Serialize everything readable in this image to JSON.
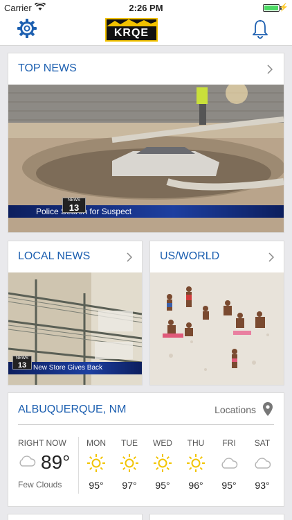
{
  "status_bar": {
    "carrier": "Carrier",
    "time": "2:26 PM"
  },
  "header": {
    "logo_text": "KRQE",
    "settings_icon": "gear-icon",
    "notifications_icon": "bell-icon"
  },
  "colors": {
    "accent": "#1c5fb0",
    "sun": "#f2c400",
    "logo_bg": "#f2c200",
    "battery": "#4cd964"
  },
  "top_news": {
    "title": "TOP NEWS",
    "station_tag": "NEWS",
    "channel": "13",
    "caption": "Police Search for Suspect"
  },
  "local_news": {
    "title": "LOCAL NEWS",
    "station_tag": "NEWS",
    "channel": "13",
    "caption": "New Store Gives Back"
  },
  "us_world": {
    "title": "US/WORLD"
  },
  "weather": {
    "city": "ALBUQUERQUE, NM",
    "locations_label": "Locations",
    "now_label": "RIGHT NOW",
    "now_temp": "89°",
    "now_condition": "Few Clouds",
    "now_icon": "cloud-icon",
    "forecast": [
      {
        "day": "MON",
        "icon": "sun-icon",
        "high": "95°"
      },
      {
        "day": "TUE",
        "icon": "sun-icon",
        "high": "97°"
      },
      {
        "day": "WED",
        "icon": "sun-icon",
        "high": "95°"
      },
      {
        "day": "THU",
        "icon": "sun-icon",
        "high": "96°"
      },
      {
        "day": "FRI",
        "icon": "cloud-icon",
        "high": "95°"
      },
      {
        "day": "SAT",
        "icon": "cloud-icon",
        "high": "93°"
      }
    ]
  }
}
